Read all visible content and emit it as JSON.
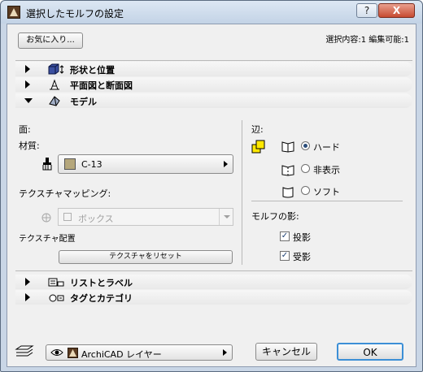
{
  "window": {
    "title": "選択したモルフの設定",
    "help_label": "?",
    "close_label": "X"
  },
  "toolbar": {
    "favorites_label": "お気に入り...",
    "selection_info": "選択内容:1 編集可能:1"
  },
  "sections": {
    "shape": "形状と位置",
    "plan": "平面図と断面図",
    "model": "モデル",
    "listing": "リストとラベル",
    "tags": "タグとカテゴリ"
  },
  "model": {
    "face_label": "面:",
    "material_label": "材質:",
    "material_value": "C-13",
    "mapping_label": "テクスチャマッピング:",
    "mapping_value": "ボックス",
    "texture_placement_label": "テクスチャ配置",
    "reset_button": "テクスチャをリセット",
    "edges_label": "辺:",
    "edge_options": [
      "ハード",
      "非表示",
      "ソフト"
    ],
    "edge_selected": 0,
    "shadow_label": "モルフの影:",
    "cast_shadow": "投影",
    "receive_shadow": "受影"
  },
  "footer": {
    "layer_value": "ArchiCAD レイヤー",
    "cancel_label": "キャンセル",
    "ok_label": "OK"
  },
  "colors": {
    "material_swatch": "#b5a77c",
    "window_frame": "#c9d6e6",
    "close_button": "#c74b32"
  }
}
